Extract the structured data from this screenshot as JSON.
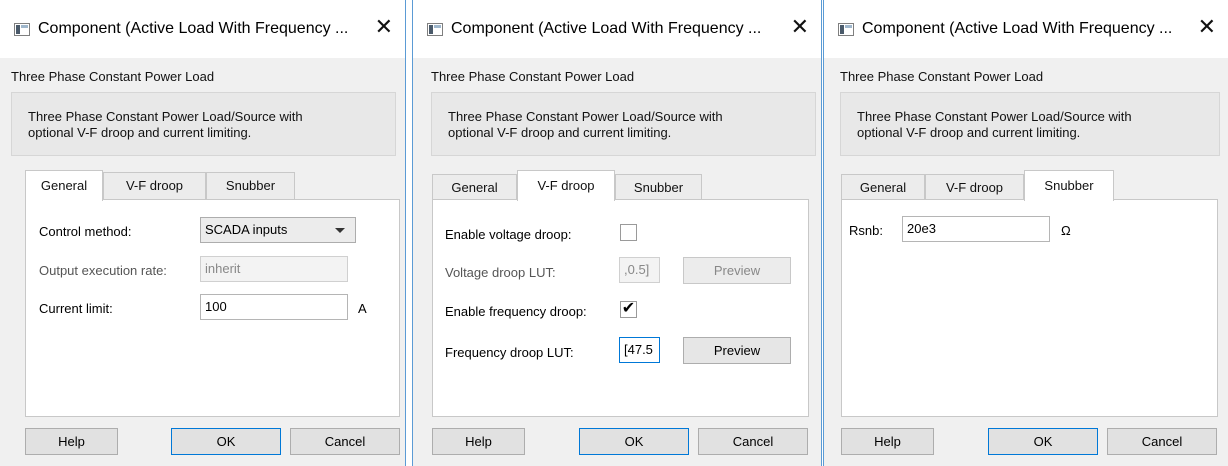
{
  "dialogs": [
    {
      "title": "Component (Active Load With Frequency ...",
      "component_type": "Three Phase Constant Power Load",
      "description_line1": "Three Phase Constant Power Load/Source with",
      "description_line2": "optional V-F droop and current limiting.",
      "tabs": [
        "General",
        "V-F droop",
        "Snubber"
      ],
      "active_tab": "General",
      "general": {
        "control_method_label": "Control method:",
        "control_method_value": "SCADA inputs",
        "exec_rate_label": "Output execution rate:",
        "exec_rate_value": "inherit",
        "current_limit_label": "Current limit:",
        "current_limit_value": "100",
        "current_limit_unit": "A"
      },
      "buttons": {
        "help": "Help",
        "ok": "OK",
        "cancel": "Cancel"
      }
    },
    {
      "title": "Component (Active Load With Frequency ...",
      "component_type": "Three Phase Constant Power Load",
      "description_line1": "Three Phase Constant Power Load/Source with",
      "description_line2": "optional V-F droop and current limiting.",
      "tabs": [
        "General",
        "V-F droop",
        "Snubber"
      ],
      "active_tab": "V-F droop",
      "vf_droop": {
        "enable_voltage_label": "Enable voltage droop:",
        "enable_voltage_checked": false,
        "voltage_lut_label": "Voltage droop LUT:",
        "voltage_lut_value": ",0.5]",
        "voltage_preview": "Preview",
        "enable_freq_label": "Enable frequency droop:",
        "enable_freq_checked": true,
        "enable_freq_mark": "✔",
        "freq_lut_label": "Frequency droop LUT:",
        "freq_lut_value": "[47.5",
        "freq_preview": "Preview"
      },
      "buttons": {
        "help": "Help",
        "ok": "OK",
        "cancel": "Cancel"
      }
    },
    {
      "title": "Component (Active Load With Frequency ...",
      "component_type": "Three Phase Constant Power Load",
      "description_line1": "Three Phase Constant Power Load/Source with",
      "description_line2": "optional V-F droop and current limiting.",
      "tabs": [
        "General",
        "V-F droop",
        "Snubber"
      ],
      "active_tab": "Snubber",
      "snubber": {
        "rsnb_label": "Rsnb:",
        "rsnb_value": "20e3",
        "rsnb_unit": "Ω"
      },
      "buttons": {
        "help": "Help",
        "ok": "OK",
        "cancel": "Cancel"
      }
    }
  ],
  "icons": {
    "close": "✕"
  },
  "colors": {
    "accent": "#0078d7",
    "divider": "#5b9bd5"
  }
}
